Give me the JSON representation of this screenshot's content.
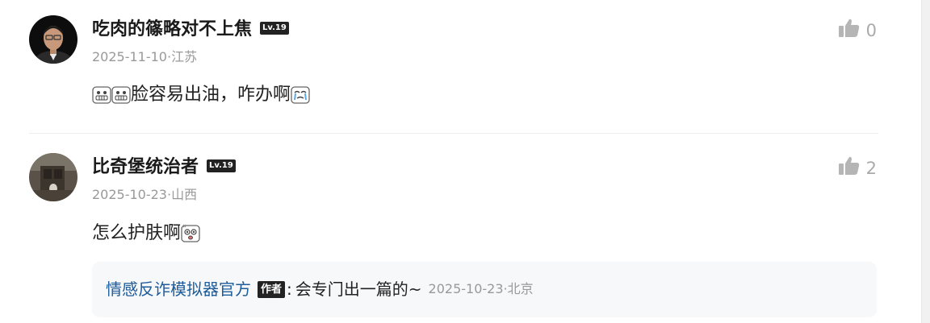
{
  "comments": [
    {
      "username": "吃肉的篠略对不上焦",
      "level": "Lv.19",
      "date_location": "2025-11-10·江苏",
      "likes": "0",
      "text": "脸容易出油，咋办啊",
      "leading_emojis": [
        "grimace-emoji",
        "grimace-emoji"
      ],
      "trailing_emoji": "crying-emoji"
    },
    {
      "username": "比奇堡统治者",
      "level": "Lv.19",
      "date_location": "2025-10-23·山西",
      "likes": "2",
      "text": "怎么护肤啊",
      "trailing_emoji": "shocked-emoji",
      "reply": {
        "username": "情感反诈模拟器官方",
        "badge": "作者",
        "colon": ":",
        "text": "会专门出一篇的~",
        "date_location": "2025-10-23·北京"
      }
    }
  ],
  "colors": {
    "reply_user": "#1d5b9a",
    "reply_bg": "#f7f8fa",
    "muted": "#999999",
    "badge_bg": "#222222"
  }
}
